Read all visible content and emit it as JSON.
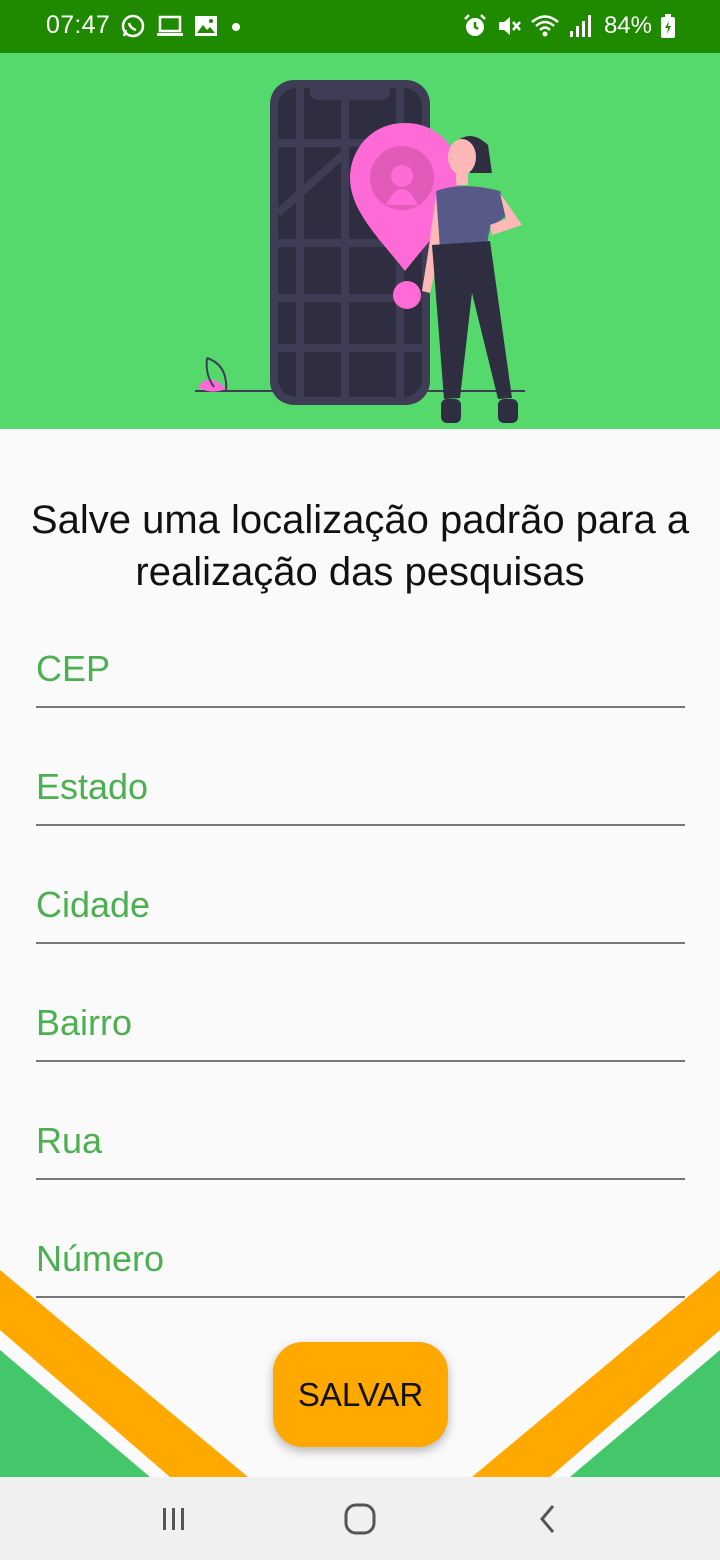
{
  "status_bar": {
    "time": "07:47",
    "left_icons": [
      "whatsapp-icon",
      "laptop-icon",
      "image-icon",
      "dot-icon"
    ],
    "right_icons": [
      "alarm-icon",
      "mute-icon",
      "wifi-icon",
      "signal-icon",
      "battery-icon"
    ],
    "battery": "84%"
  },
  "hero": {
    "illustration": "woman-with-phone-map-location-pin",
    "background_color": "#55d96c"
  },
  "headline": "Salve uma localização padrão para a realização das pesquisas",
  "form": {
    "fields": [
      {
        "id": "cep",
        "placeholder": "CEP",
        "value": ""
      },
      {
        "id": "estado",
        "placeholder": "Estado",
        "value": ""
      },
      {
        "id": "cidade",
        "placeholder": "Cidade",
        "value": ""
      },
      {
        "id": "bairro",
        "placeholder": "Bairro",
        "value": ""
      },
      {
        "id": "rua",
        "placeholder": "Rua",
        "value": ""
      },
      {
        "id": "numero",
        "placeholder": "Número",
        "value": ""
      }
    ]
  },
  "save_button": {
    "label": "SALVAR",
    "color": "#ffa800"
  },
  "nav_bar": {
    "items": [
      "recent-apps-icon",
      "home-icon",
      "back-icon"
    ]
  },
  "colors": {
    "primary_green": "#55d96c",
    "status_green": "#1f8a00",
    "accent_orange": "#ffa800",
    "label_green": "#4caf50"
  }
}
